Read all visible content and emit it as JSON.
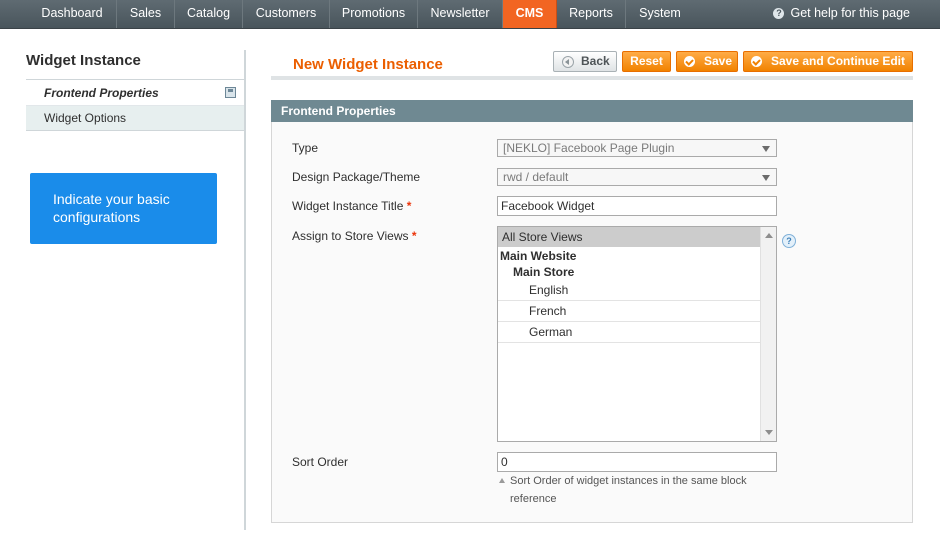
{
  "nav": {
    "items": [
      {
        "label": "Dashboard"
      },
      {
        "label": "Sales"
      },
      {
        "label": "Catalog"
      },
      {
        "label": "Customers"
      },
      {
        "label": "Promotions"
      },
      {
        "label": "Newsletter"
      },
      {
        "label": "CMS",
        "active": true
      },
      {
        "label": "Reports"
      },
      {
        "label": "System"
      }
    ],
    "help_label": "Get help for this page",
    "active_color": "#f26522"
  },
  "sidebar": {
    "title": "Widget Instance",
    "tabs": [
      {
        "label": "Frontend Properties",
        "active": true
      },
      {
        "label": "Widget Options"
      }
    ],
    "hint": "Indicate your basic configurations",
    "hint_color": "#1a8cea"
  },
  "header": {
    "title": "New Widget Instance",
    "buttons": {
      "back": "Back",
      "reset": "Reset",
      "save": "Save",
      "save_continue": "Save and Continue Edit"
    }
  },
  "fieldset": {
    "title": "Frontend Properties",
    "fields": {
      "type": {
        "label": "Type",
        "value": "[NEKLO] Facebook Page Plugin"
      },
      "design": {
        "label": "Design Package/Theme",
        "value": "rwd / default"
      },
      "title": {
        "label": "Widget Instance Title",
        "value": "Facebook Widget",
        "required": "*"
      },
      "store_views": {
        "label": "Assign to Store Views",
        "required": "*",
        "options": {
          "all": "All Store Views",
          "website": "Main Website",
          "store": "Main Store",
          "views": [
            "English",
            "French",
            "German"
          ]
        }
      },
      "sort_order": {
        "label": "Sort Order",
        "value": "0",
        "note": "Sort Order of widget instances in the same block reference"
      }
    }
  }
}
